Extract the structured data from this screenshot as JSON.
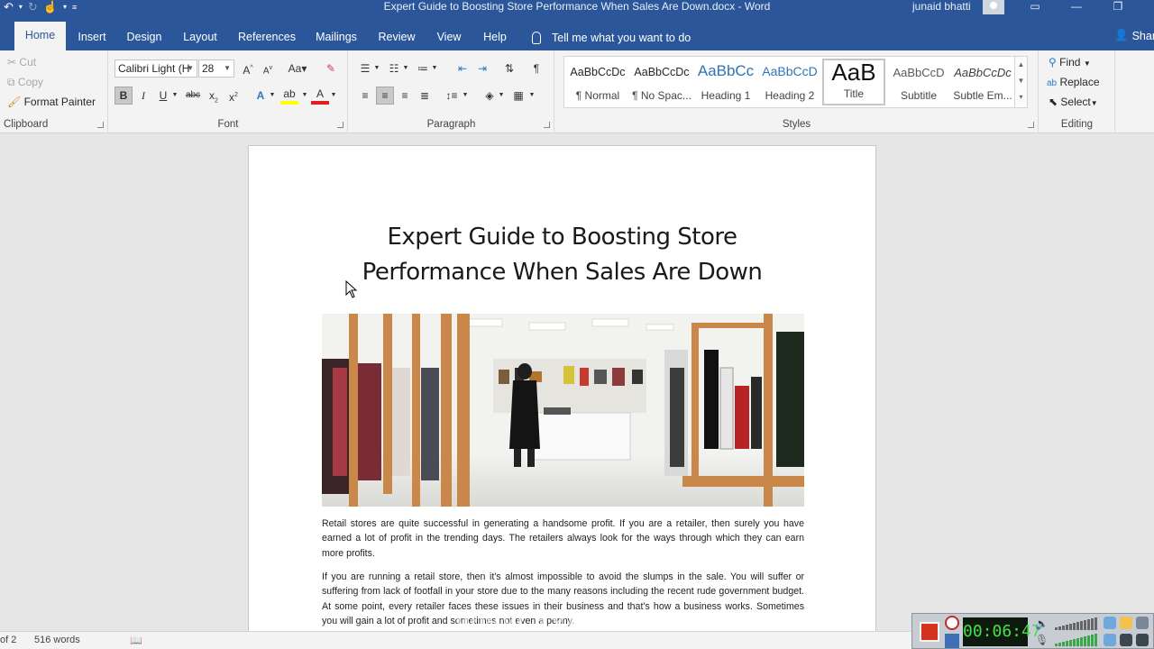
{
  "titlebar": {
    "title": "Expert Guide to Boosting Store Performance When Sales Are Down.docx  -  Word",
    "user": "junaid bhatti"
  },
  "tabs": [
    "Home",
    "Insert",
    "Design",
    "Layout",
    "References",
    "Mailings",
    "Review",
    "View",
    "Help"
  ],
  "tellme": "Tell me what you want to do",
  "share": "Share",
  "clipboard": {
    "cut": "Cut",
    "copy": "Copy",
    "format_painter": "Format Painter",
    "label": "Clipboard"
  },
  "font": {
    "name": "Calibri Light (H",
    "size": "28",
    "case_label": "Aa",
    "label": "Font"
  },
  "paragraph": {
    "label": "Paragraph"
  },
  "styles": {
    "label": "Styles",
    "items": [
      {
        "preview": "AaBbCcDc",
        "name": "¶ Normal"
      },
      {
        "preview": "AaBbCcDc",
        "name": "¶ No Spac..."
      },
      {
        "preview": "AaBbCc",
        "name": "Heading 1"
      },
      {
        "preview": "AaBbCcD",
        "name": "Heading 2"
      },
      {
        "preview": "AaB",
        "name": "Title"
      },
      {
        "preview": "AaBbCcD",
        "name": "Subtitle"
      },
      {
        "preview": "AaBbCcDc",
        "name": "Subtle Em..."
      }
    ],
    "colors": {
      "heading": "#2e74b5",
      "normal": "#000000",
      "subtitle": "#595959"
    }
  },
  "editing": {
    "find": "Find",
    "replace": "Replace",
    "select": "Select",
    "label": "Editing"
  },
  "document": {
    "title_line1": "Expert Guide to Boosting Store",
    "title_line2": "Performance When Sales Are Down",
    "paragraph1": "Retail stores are quite successful in generating a handsome profit. If you are a retailer, then surely you have earned a lot of profit in the trending days. The retailers always look for the ways through which they can earn more profits.",
    "paragraph2": "If you are running a retail store, then it’s almost impossible to avoid the slumps in the sale. You will suffer or suffering from lack of footfall in your store due to the many reasons including the recent rude government budget. At some point, every retailer faces these issues in their business and that’s how a business works. Sometimes you will gain a lot of profit and sometimes not even a penny."
  },
  "statusbar": {
    "page": "of 2",
    "words": "516 words"
  },
  "recorder": {
    "time": "00:06:47"
  },
  "colors": {
    "accent": "#2b579a",
    "ribbon": "#f3f3f3",
    "canvas": "#e6e6e6"
  }
}
